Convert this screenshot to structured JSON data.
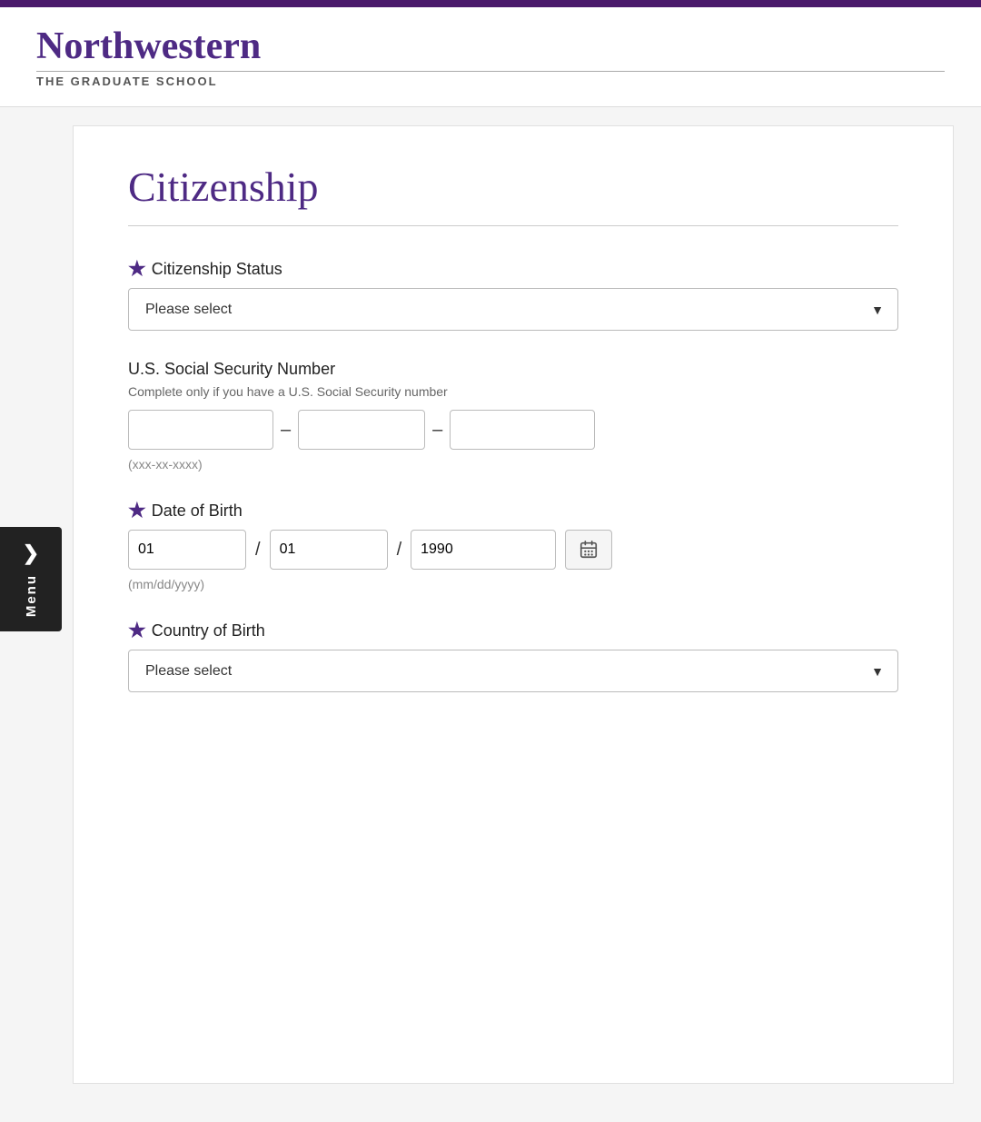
{
  "topBar": {
    "color": "#4a1a6b"
  },
  "header": {
    "logo_name": "Northwestern",
    "logo_subtitle": "THE GRADUATE SCHOOL"
  },
  "sideMenu": {
    "arrow": "❯",
    "label": "Menu"
  },
  "page": {
    "title": "Citizenship",
    "fields": {
      "citizenshipStatus": {
        "label": "Citizenship Status",
        "required": true,
        "placeholder": "Please select"
      },
      "ssn": {
        "label": "U.S. Social Security Number",
        "required": false,
        "hint": "Complete only if you have a U.S. Social Security number",
        "format": "(xxx-xx-xxxx)",
        "part1": "",
        "part2": "",
        "part3": ""
      },
      "dob": {
        "label": "Date of Birth",
        "required": true,
        "month": "01",
        "day": "01",
        "year": "1990",
        "format": "(mm/dd/yyyy)"
      },
      "countryOfBirth": {
        "label": "Country of Birth",
        "required": true,
        "placeholder": "Please select"
      }
    }
  }
}
